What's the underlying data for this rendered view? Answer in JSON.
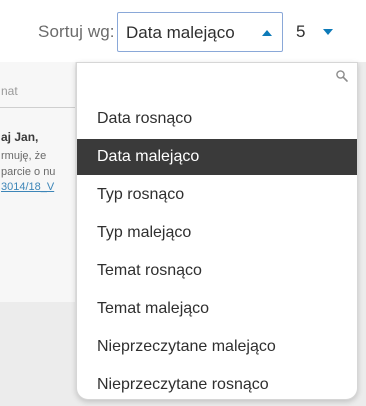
{
  "sort": {
    "label": "Sortuj wg:",
    "selected": "Data malejąco",
    "page_size": "5"
  },
  "background": {
    "filter_placeholder": "nat",
    "sender": "aj Jan,",
    "line1": "rmuję, że",
    "line2": "parcie o nu",
    "link": "3014/18_V"
  },
  "dropdown": {
    "options": [
      "Data rosnąco",
      "Data malejąco",
      "Typ rosnąco",
      "Typ malejąco",
      "Temat rosnąco",
      "Temat malejąco",
      "Nieprzeczytane malejąco",
      "Nieprzeczytane rosnąco"
    ],
    "selected_index": 1
  },
  "colors": {
    "accent": "#0d7ab8",
    "selected_bg": "#3a3a3a",
    "select_border": "#8aa8d8"
  },
  "icons": {
    "search": "search-icon",
    "sort_caret": "caret-up-icon",
    "page_size_caret": "caret-down-icon"
  }
}
